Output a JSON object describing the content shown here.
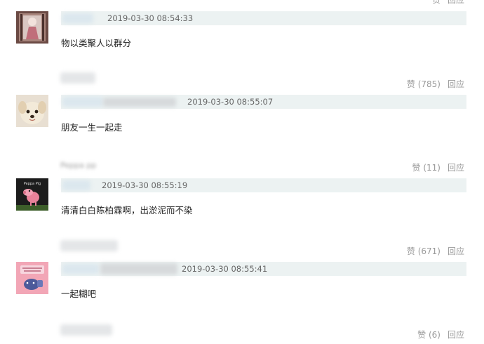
{
  "comments": [
    {
      "timestamp": "2019-03-30 08:54:33",
      "text": "物以类聚人以群分",
      "like_count": "",
      "reply": "回应"
    },
    {
      "timestamp": "2019-03-30 08:55:07",
      "text": "朋友一生一起走",
      "like_count": "(785)",
      "reply": "回应"
    },
    {
      "timestamp": "2019-03-30 08:55:19",
      "text": "清清白白陈柏霖啊，出淤泥而不染",
      "like_count": "(11)",
      "reply": "回应"
    },
    {
      "timestamp": "2019-03-30 08:55:41",
      "text": "一起糊吧",
      "like_count": "(671)",
      "reply": "回应"
    }
  ],
  "footer_actions": [
    {
      "like_count": "(6)",
      "reply": "回应"
    }
  ],
  "ui": {
    "like_label": "赞",
    "reply_label": "回应",
    "avatar3_caption": "Peppa Pig",
    "blurred_name_3": "Peppa",
    "blurred_username_3": "pp"
  },
  "colors": {
    "meta_bar": "#ecf2f2",
    "timestamp": "#666666",
    "action_text": "#9a9a9a"
  },
  "icons": {
    "avatar_1": "doll-photo-avatar",
    "avatar_2": "puppy-avatar",
    "avatar_3": "peppa-pig-avatar",
    "avatar_4": "pink-cartoon-avatar"
  }
}
